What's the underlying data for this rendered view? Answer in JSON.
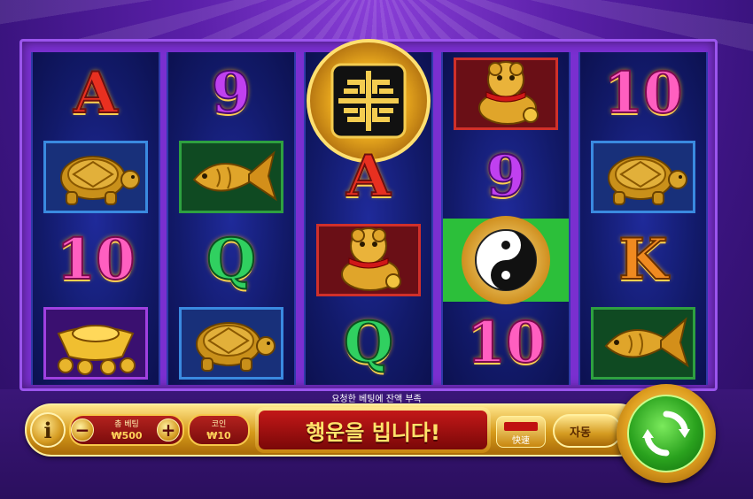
{
  "reels": [
    {
      "symbols": [
        {
          "kind": "letter",
          "text": "A",
          "color": "red"
        },
        {
          "kind": "icon",
          "name": "turtle-icon",
          "tile": "blue"
        },
        {
          "kind": "letter",
          "text": "10",
          "color": "pink"
        },
        {
          "kind": "icon",
          "name": "gold-ingot-icon",
          "tile": "purple"
        }
      ]
    },
    {
      "symbols": [
        {
          "kind": "letter",
          "text": "9",
          "color": "purple"
        },
        {
          "kind": "icon",
          "name": "koi-fish-icon",
          "tile": "green"
        },
        {
          "kind": "letter",
          "text": "Q",
          "color": "green"
        },
        {
          "kind": "icon",
          "name": "turtle-icon",
          "tile": "blue"
        }
      ]
    },
    {
      "symbols": [
        {
          "kind": "icon",
          "name": "gold-coin-icon",
          "tile": "none"
        },
        {
          "kind": "letter",
          "text": "A",
          "color": "red"
        },
        {
          "kind": "icon",
          "name": "foo-dog-icon",
          "tile": "red"
        },
        {
          "kind": "letter",
          "text": "Q",
          "color": "green"
        }
      ]
    },
    {
      "symbols": [
        {
          "kind": "icon",
          "name": "foo-dog-icon",
          "tile": "red"
        },
        {
          "kind": "letter",
          "text": "9",
          "color": "purple"
        },
        {
          "kind": "icon",
          "name": "yin-yang-icon",
          "tile": "highlight"
        },
        {
          "kind": "letter",
          "text": "10",
          "color": "pink"
        }
      ]
    },
    {
      "symbols": [
        {
          "kind": "letter",
          "text": "10",
          "color": "pink"
        },
        {
          "kind": "icon",
          "name": "turtle-icon",
          "tile": "blue"
        },
        {
          "kind": "letter",
          "text": "K",
          "color": "orange"
        },
        {
          "kind": "icon",
          "name": "koi-fish-icon",
          "tile": "green"
        }
      ]
    }
  ],
  "status_message": "요청한 베팅에 잔액 부족",
  "controls": {
    "info_label": "i",
    "minus_label": "−",
    "plus_label": "+",
    "total_bet_label": "총 베팅",
    "total_bet_value": "₩500",
    "coin_label": "코인",
    "coin_value": "₩10",
    "banner_text": "행운을 빕니다!",
    "quick_label": "快速",
    "auto_label": "자동"
  },
  "colors": {
    "frame": "#7a2fd0",
    "banner_red": "#c31818",
    "gold": "#f7c84a",
    "spin_green": "#2aa21e"
  }
}
